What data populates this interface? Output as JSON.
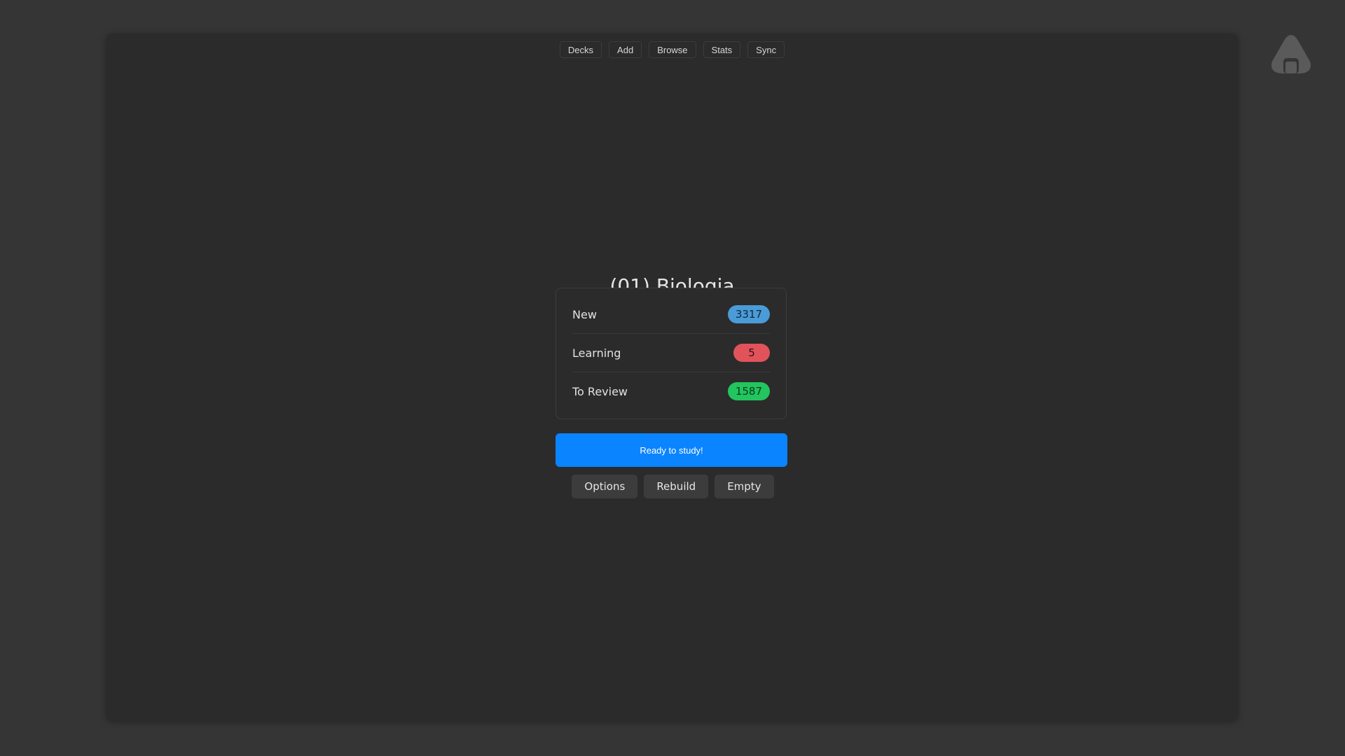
{
  "toolbar": {
    "items": [
      {
        "label": "Decks"
      },
      {
        "label": "Add"
      },
      {
        "label": "Browse"
      },
      {
        "label": "Stats"
      },
      {
        "label": "Sync"
      }
    ]
  },
  "deck": {
    "title": "(01) Biologia",
    "counts": [
      {
        "label": "New",
        "value": "3317",
        "color": "#4a9bd8"
      },
      {
        "label": "Learning",
        "value": "5",
        "color": "#e0535b"
      },
      {
        "label": "To Review",
        "value": "1587",
        "color": "#22c55e"
      }
    ]
  },
  "study_button": {
    "label": "Ready to study!",
    "color": "#0a84ff"
  },
  "actions": [
    {
      "label": "Options"
    },
    {
      "label": "Rebuild"
    },
    {
      "label": "Empty"
    }
  ],
  "icons": {
    "mascot": "onigiri-icon"
  }
}
